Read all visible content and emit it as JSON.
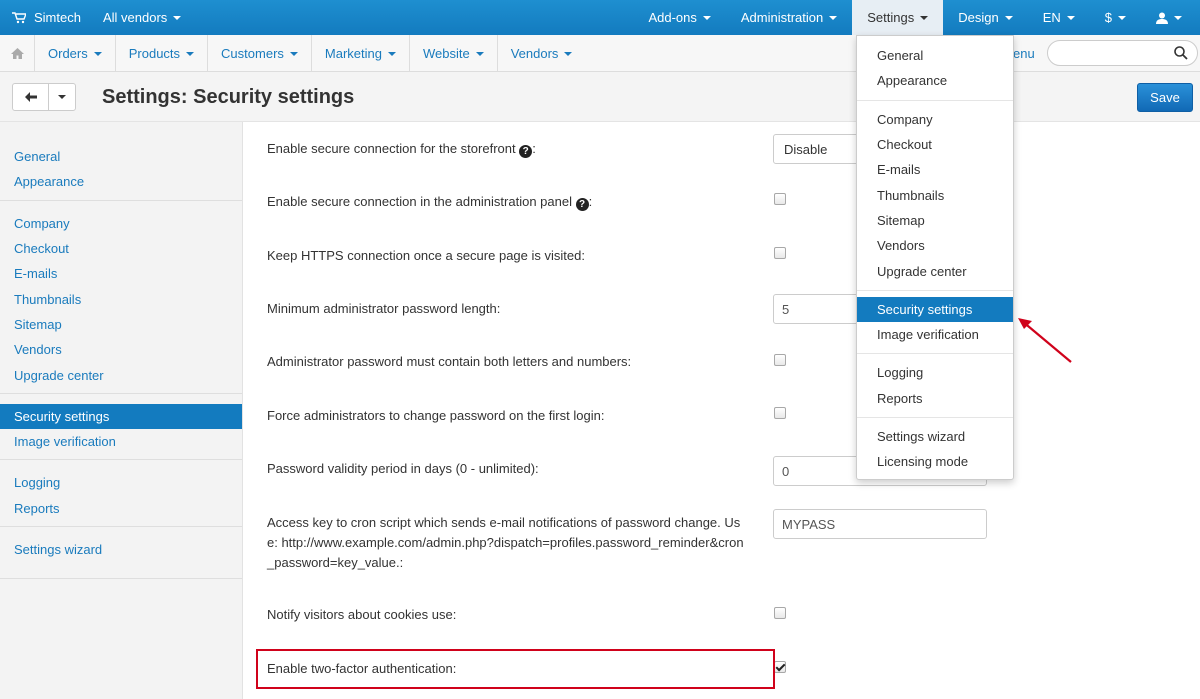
{
  "topbar": {
    "brand": "Simtech",
    "vendors": "All vendors",
    "nav": [
      "Add-ons",
      "Administration",
      "Settings",
      "Design",
      "EN",
      "$"
    ]
  },
  "secnav": {
    "items": [
      "Orders",
      "Products",
      "Customers",
      "Marketing",
      "Website",
      "Vendors"
    ],
    "menu_fragment": "enu",
    "search_placeholder": ""
  },
  "page": {
    "title": "Settings: Security settings",
    "save_label": "Save"
  },
  "sidebar": {
    "groups": [
      [
        "General",
        "Appearance"
      ],
      [
        "Company",
        "Checkout",
        "E-mails",
        "Thumbnails",
        "Sitemap",
        "Vendors",
        "Upgrade center"
      ],
      [
        "Security settings",
        "Image verification"
      ],
      [
        "Logging",
        "Reports"
      ],
      [
        "Settings wizard"
      ]
    ],
    "active": "Security settings"
  },
  "settings": [
    {
      "label": "Enable secure connection for the storefront",
      "help": true,
      "control": "select",
      "value": "Disable"
    },
    {
      "label": "Enable secure connection in the administration panel",
      "help": true,
      "control": "checkbox",
      "checked": false
    },
    {
      "label": "Keep HTTPS connection once a secure page is visited:",
      "control": "checkbox",
      "checked": false
    },
    {
      "label": "Minimum administrator password length:",
      "control": "input",
      "value": "5"
    },
    {
      "label": "Administrator password must contain both letters and numbers:",
      "control": "checkbox",
      "checked": false
    },
    {
      "label": "Force administrators to change password on the first login:",
      "control": "checkbox",
      "checked": false
    },
    {
      "label": "Password validity period in days (0 - unlimited):",
      "control": "input",
      "value": "0"
    },
    {
      "label": "Access key to cron script which sends e-mail notifications of password change. Use: http://www.example.com/admin.php?dispatch=profiles.password_reminder&cron_password=key_value.:",
      "control": "input",
      "value": "MYPASS"
    },
    {
      "label": "Notify visitors about cookies use:",
      "control": "checkbox",
      "checked": false
    },
    {
      "label": "Enable two-factor authentication:",
      "control": "checkbox",
      "checked": true
    }
  ],
  "dropdown": {
    "groups": [
      [
        "General",
        "Appearance"
      ],
      [
        "Company",
        "Checkout",
        "E-mails",
        "Thumbnails",
        "Sitemap",
        "Vendors",
        "Upgrade center"
      ],
      [
        "Security settings",
        "Image verification"
      ],
      [
        "Logging",
        "Reports"
      ],
      [
        "Settings wizard",
        "Licensing mode"
      ]
    ],
    "active": "Security settings"
  },
  "colors": {
    "topbar": "#137bbf",
    "link": "#1a7bbd",
    "active": "#137bbf",
    "highlight_box": "#d0021b",
    "arrow": "#d0021b"
  }
}
